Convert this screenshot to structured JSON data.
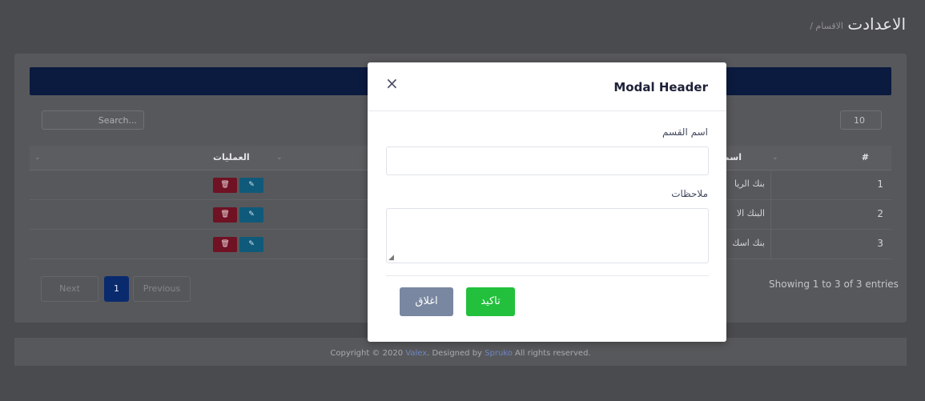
{
  "page": {
    "title": "الاعدادت",
    "breadcrumb": "/ الاقسام",
    "search_placeholder": "Search...",
    "page_length": "10",
    "table": {
      "headers": {
        "index": "#",
        "name": "اسم",
        "actions": "العمليات"
      },
      "rows": [
        {
          "index": "1",
          "name": "بنك الريا"
        },
        {
          "index": "2",
          "name": "البنك الا"
        },
        {
          "index": "3",
          "name": "بنك اسك"
        }
      ],
      "edit_icon": "pencil-icon",
      "delete_icon": "trash-icon"
    },
    "pagination": {
      "previous": "Previous",
      "current": "1",
      "next": "Next"
    },
    "entries_info": "Showing 1 to 3 of 3 entries",
    "footer": {
      "prefix": "Copyright © 2020 ",
      "brand": "Valex",
      "middle": ". Designed by ",
      "author": "Spruko",
      "suffix": " All rights reserved."
    }
  },
  "modal": {
    "title": "Modal Header",
    "close_icon": "×",
    "fields": {
      "section_name_label": "اسم القسم",
      "section_name_value": "",
      "notes_label": "ملاحظات",
      "notes_value": ""
    },
    "buttons": {
      "confirm": "تاكيد",
      "close": "اغلاق"
    }
  },
  "colors": {
    "overlay_bg": "#4a4b4e",
    "header_bar": "#0b1a3f",
    "confirm_button": "#22c03c",
    "close_button": "#7987a1",
    "edit_button": "#0f5a7a",
    "delete_button": "#6e1224",
    "page_active": "#0a2a6e"
  }
}
